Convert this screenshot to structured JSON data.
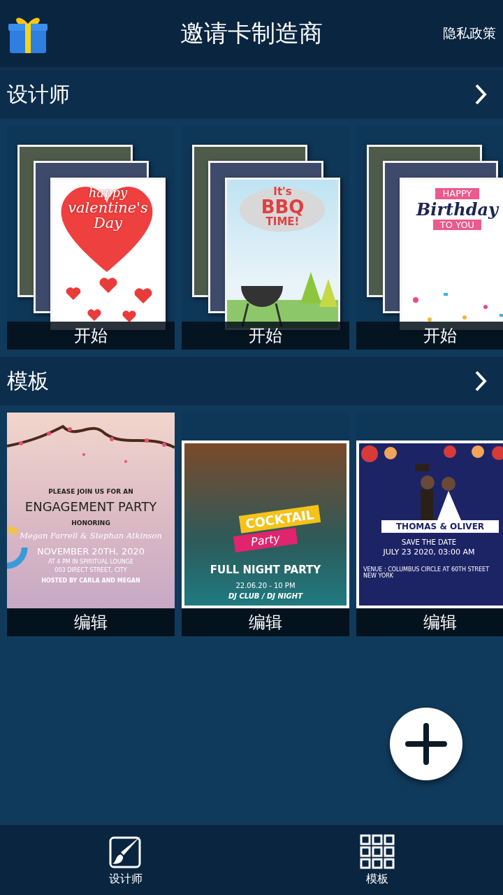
{
  "header": {
    "title": "邀请卡制造商",
    "privacy_link": "隐私政策"
  },
  "sections": [
    {
      "title": "设计师",
      "kind": "designer",
      "cards": [
        {
          "kind": "valentine",
          "action": "开始",
          "lines": [
            {
              "kind": "script",
              "text": "happy"
            },
            {
              "kind": "script-big",
              "text": "valentine's"
            },
            {
              "kind": "script-big",
              "text": "Day"
            }
          ]
        },
        {
          "kind": "bbq",
          "action": "开始",
          "lines": [
            {
              "kind": "cloud-small",
              "text": "It's"
            },
            {
              "kind": "cloud-big",
              "text": "BBQ"
            },
            {
              "kind": "cloud-small",
              "text": "TIME!"
            }
          ]
        },
        {
          "kind": "birthday",
          "action": "开始",
          "lines": [
            {
              "kind": "ribbon",
              "text": "HAPPY"
            },
            {
              "kind": "script-navy",
              "text": "Birthday"
            },
            {
              "kind": "ribbon",
              "text": "TO YOU"
            }
          ]
        }
      ]
    },
    {
      "title": "模板",
      "kind": "template",
      "cards": [
        {
          "kind": "engagement",
          "action": "编辑",
          "lines": [
            {
              "kind": "small",
              "text": "PLEASE JOIN US FOR AN"
            },
            {
              "kind": "title",
              "text": "ENGAGEMENT PARTY"
            },
            {
              "kind": "small",
              "text": "HONORING"
            },
            {
              "kind": "script-white",
              "text": "Megan Farrell & Stephan Atkinson"
            },
            {
              "kind": "date-white",
              "text": "NOVEMBER 20TH, 2020"
            },
            {
              "kind": "tiny-white",
              "text": "AT 4 PM IN SPIRITUAL LOUNGE"
            },
            {
              "kind": "tiny-white",
              "text": "003 DIRECT STREET, CITY"
            },
            {
              "kind": "host",
              "text": "HOSTED BY CARLA AND MEGAN"
            }
          ]
        },
        {
          "kind": "cocktail",
          "action": "编辑",
          "lines": [
            {
              "kind": "banner-yellow",
              "text": "COCKTAIL"
            },
            {
              "kind": "banner-pink",
              "text": "Party"
            },
            {
              "kind": "title-white",
              "text": "FULL NIGHT PARTY"
            },
            {
              "kind": "body-white",
              "text": "22.06.20 - 10 PM"
            },
            {
              "kind": "bold-white",
              "text": "DJ CLUB / DJ NIGHT"
            }
          ]
        },
        {
          "kind": "wedding",
          "action": "编辑",
          "lines": [
            {
              "kind": "nameplate",
              "text": "THOMAS & OLIVER"
            },
            {
              "kind": "body-white",
              "text": "SAVE THE DATE"
            },
            {
              "kind": "date-white",
              "text": "JULY 23 2020, 03:00 AM"
            },
            {
              "kind": "venue",
              "text": "VENUE : COLUMBUS CIRCLE AT 60TH STREET NEW YORK"
            }
          ]
        }
      ]
    }
  ],
  "nav": [
    {
      "label": "设计师",
      "kind": "brush"
    },
    {
      "label": "模板",
      "kind": "grid"
    }
  ]
}
